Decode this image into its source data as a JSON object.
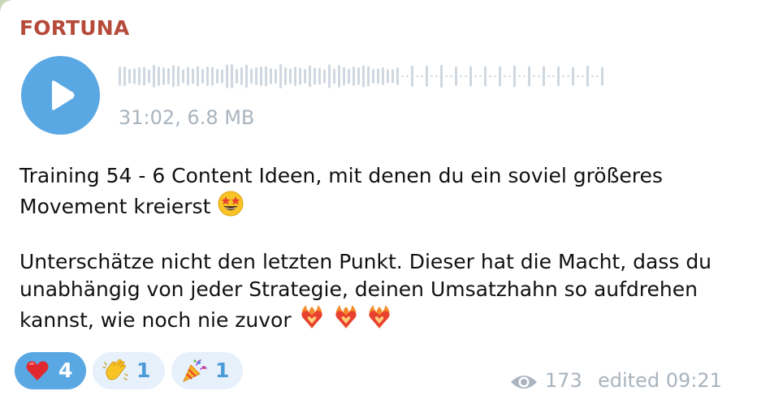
{
  "message": {
    "sender": "FORTUNA",
    "audio": {
      "meta": "31:02, 6.8 MB",
      "play_icon": "play-icon",
      "progress": 0
    },
    "text": {
      "line1": "Training 54 - 6 Content Ideen, mit denen du ein soviel größeres",
      "line2": "Movement kreierst",
      "emoji1": "star-struck-emoji",
      "para2": "Unterschätze nicht den letzten Punkt. Dieser hat die Macht, dass du unabhängig von jeder Strategie, deinen Umsatzhahn so aufdrehen kannst, wie noch nie zuvor",
      "emoji2": "heart-on-fire-emoji ×3"
    },
    "reactions": [
      {
        "icon": "red-heart-emoji",
        "count": "4",
        "active": true
      },
      {
        "icon": "clapping-hands-emoji",
        "count": "1",
        "active": false
      },
      {
        "icon": "party-popper-emoji",
        "count": "1",
        "active": false
      }
    ],
    "footer": {
      "views": "173",
      "edited": "edited 09:21",
      "views_icon": "eye-icon"
    }
  },
  "colors": {
    "sender": "#b64a3a",
    "accent": "#5aa8e3",
    "muted": "#a9b4bf",
    "reaction_bg": "#e7f1fb"
  }
}
